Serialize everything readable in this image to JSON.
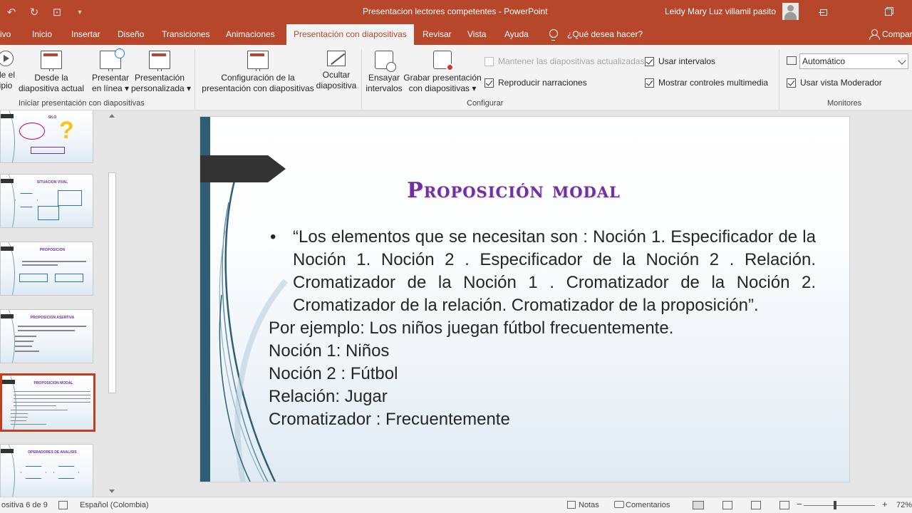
{
  "window": {
    "title": "Presentacion lectores competentes - PowerPoint",
    "user": "Leidy Mary Luz villamil pasito"
  },
  "tabs": [
    {
      "label": "ivo"
    },
    {
      "label": "Inicio"
    },
    {
      "label": "Insertar"
    },
    {
      "label": "Diseño"
    },
    {
      "label": "Transiciones"
    },
    {
      "label": "Animaciones"
    },
    {
      "label": "Presentación con diapositivas",
      "active": true
    },
    {
      "label": "Revisar"
    },
    {
      "label": "Vista"
    },
    {
      "label": "Ayuda"
    }
  ],
  "tell_me": "¿Qué desea hacer?",
  "share": "Compar",
  "ribbon": {
    "start": {
      "from_beginning": [
        "de el",
        "ipio"
      ],
      "from_current": [
        "Desde la",
        "diapositiva actual"
      ],
      "present_online": [
        "Presentar",
        "en línea"
      ],
      "custom_show": [
        "Presentación",
        "personalizada"
      ],
      "group_label": "Iniciar presentación con diapositivas"
    },
    "configure": {
      "setup": [
        "Configuración de la",
        "presentación con diapositivas"
      ],
      "hide": [
        "Ocultar",
        "diapositiva"
      ],
      "rehearse": [
        "Ensayar",
        "intervalos"
      ],
      "record": [
        "Grabar presentación",
        "con diapositivas"
      ],
      "keep_updated": "Mantener las diapositivas actualizadas",
      "play_narrations": "Reproducir narraciones",
      "use_timings": "Usar intervalos",
      "show_media_controls": "Mostrar controles multimedia",
      "group_label": "Configurar"
    },
    "monitors": {
      "monitor_value": "Automático",
      "presenter_view": "Usar vista Moderador",
      "group_label": "Monitores"
    }
  },
  "thumbnails": [
    {
      "title": "SILO"
    },
    {
      "title": "SITUACIÓN VIVAL"
    },
    {
      "title": "PROPOSICIÓN"
    },
    {
      "title": "PROPOSICIÓN ASERTIVA"
    },
    {
      "title": "PROPOSICIÓN MODAL",
      "selected": true
    },
    {
      "title": "OPERADORES DE ANALISIS"
    }
  ],
  "slide": {
    "title": "Proposición modal",
    "bullet": "“Los elementos que se necesitan son : Noción 1. Especificador de la Noción 1. Noción 2 . Especificador de la Noción 2 . Relación. Cromatizador de la Noción 1 . Cromatizador de la Noción 2. Cromatizador de la relación. Cromatizador de la proposición”.",
    "lines": [
      "Por ejemplo: Los niños juegan fútbol frecuentemente.",
      "Noción 1: Niños",
      "Noción 2 : Fútbol",
      "Relación: Jugar",
      "Cromatizador : Frecuentemente"
    ]
  },
  "status": {
    "slide_count": "ositiva 6 de 9",
    "language": "Español (Colombia)",
    "notes": "Notas",
    "comments": "Comentarios",
    "zoom": "72%"
  }
}
